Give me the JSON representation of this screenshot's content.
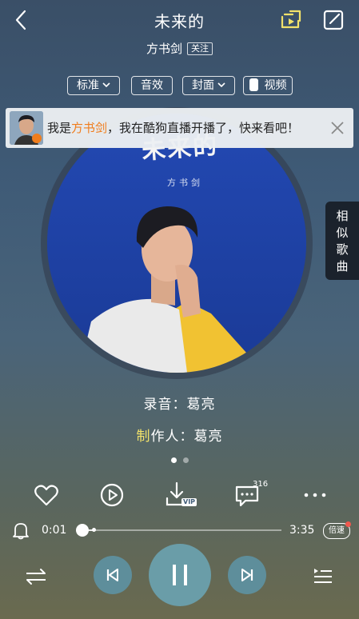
{
  "header": {
    "title": "未来的",
    "artist": "方书剑",
    "follow_label": "关注",
    "icons": [
      "back-arrow-icon",
      "share-screen-icon",
      "edit-icon"
    ]
  },
  "options": {
    "quality": "标准",
    "effect": "音效",
    "cover": "封面",
    "video": "视频"
  },
  "banner": {
    "prefix": "我是",
    "name": "方书剑",
    "suffix": "，我在酷狗直播开播了，快来看吧！",
    "highlight_color": "#f07d1d"
  },
  "album": {
    "cover_title": "未来的",
    "cover_artist": "方书剑"
  },
  "similar_songs": [
    "相",
    "似",
    "歌",
    "曲"
  ],
  "credits": {
    "line1": "录音：葛亮",
    "line2_first": "制",
    "line2_rest": "作人：葛亮"
  },
  "pager": {
    "count": 2,
    "active": 0
  },
  "actions": {
    "comment_count": "316",
    "download_badge": "VIP"
  },
  "progress": {
    "current": "0:01",
    "total": "3:35",
    "fraction": 0.005,
    "speed_label": "倍速"
  },
  "colors": {
    "accent_teal": "#6a9da8",
    "notify_dot": "#f0584e"
  }
}
